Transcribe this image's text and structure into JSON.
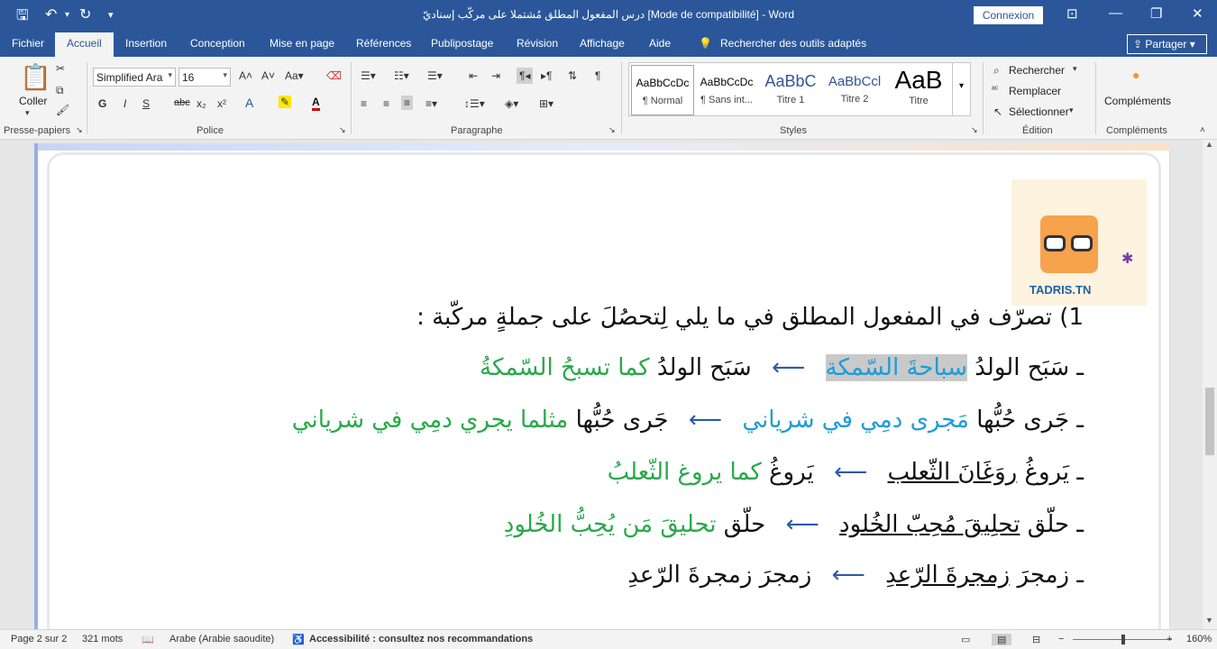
{
  "titlebar": {
    "title": "درس المفعول المطلق مُشتملا على مركّب إسناديّ [Mode de compatibilité]  -  Word",
    "signin": "Connexion"
  },
  "menu": {
    "tabs": [
      "Fichier",
      "Accueil",
      "Insertion",
      "Conception",
      "Mise en page",
      "Références",
      "Publipostage",
      "Révision",
      "Affichage",
      "Aide"
    ],
    "tellme": "Rechercher des outils adaptés",
    "share": "Partager"
  },
  "ribbon": {
    "paste_label": "Coller",
    "groups": {
      "clipboard": "Presse-papiers",
      "font": "Police",
      "paragraph": "Paragraphe",
      "styles": "Styles",
      "editing": "Édition",
      "addins": "Compléments"
    },
    "font_name": "Simplified Ara",
    "font_size": "16",
    "styles": [
      {
        "sample": "AaBbCcDc",
        "name": "¶ Normal"
      },
      {
        "sample": "AaBbCcDc",
        "name": "¶ Sans int..."
      },
      {
        "sample": "AaBbC",
        "name": "Titre 1"
      },
      {
        "sample": "AaBbCcl",
        "name": "Titre 2"
      },
      {
        "sample": "AaB",
        "name": "Titre"
      }
    ],
    "editing": {
      "find": "Rechercher",
      "replace": "Remplacer",
      "select": "Sélectionner"
    },
    "addins_button": "Compléments",
    "format_buttons": {
      "bold": "G",
      "italic": "I",
      "underline": "S"
    }
  },
  "document": {
    "logo_text": "TADRIS.TN",
    "heading": "1) تصرّف في المفعول المطلق في ما يلي لِتحصُلَ على جملةٍ مركّبة :",
    "rows": [
      {
        "dash": "ـ",
        "source_plain": "سَبَح الولدُ ",
        "source_mark": "سباحةَ السّمكة",
        "arrow": "⟵",
        "result_plain": "سَبَح الولدُ ",
        "result_green": "كما تسبحُ السّمكةُ"
      },
      {
        "dash": "ـ",
        "source_plain": "جَرى حُبُّها ",
        "source_mark": "مَجرى دمِي في شرياني",
        "arrow": "⟵",
        "result_plain": "جَرى حُبُّها ",
        "result_green": "مثلما يجري دمِي في شرياني"
      },
      {
        "dash": "ـ",
        "source_plain": "يَروغُ ",
        "source_mark": "روَغَانَ الثّعلب",
        "arrow": "⟵",
        "result_plain": "يَروغُ ",
        "result_green": "كما يروغ الثّعلبُ"
      },
      {
        "dash": "ـ",
        "source_plain": "حلّق ",
        "source_mark": "تحلِيقَ مُحِبّ الخُلود",
        "arrow": "⟵",
        "result_plain": "حلّق ",
        "result_green": "تحليقَ مَن يُحِبُّ الخُلودِ"
      },
      {
        "dash": "ـ",
        "source_plain": "زمجرَ ",
        "source_mark": "زمجرةَ الرّعدِ",
        "arrow": "⟵",
        "result_plain": "زمجرَ زمجرةَ الرّعدِ",
        "result_green": ""
      }
    ]
  },
  "statusbar": {
    "page": "Page 2 sur 2",
    "words": "321 mots",
    "language": "Arabe (Arabie saoudite)",
    "accessibility": "Accessibilité : consultez nos recommandations",
    "zoom": "160%"
  }
}
